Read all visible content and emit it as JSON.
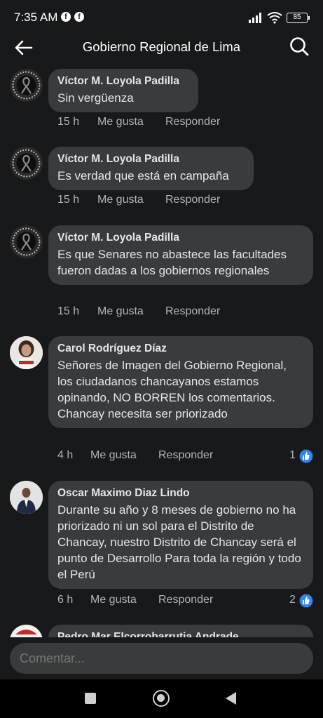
{
  "status_bar": {
    "time": "7:35 AM",
    "battery": "85",
    "icons": [
      "facebook-icon",
      "facebook-icon",
      "signal-icon",
      "wifi-icon",
      "battery-icon"
    ]
  },
  "header": {
    "title": "Gobierno Regional de Lima",
    "back_icon": "back-arrow-icon",
    "search_icon": "search-icon"
  },
  "comments": [
    {
      "author": "Víctor M. Loyola Padilla",
      "text": "Sin vergüenza",
      "time": "15 h",
      "like_label": "Me gusta",
      "reply_label": "Responder",
      "reactions": ""
    },
    {
      "author": "Víctor M. Loyola Padilla",
      "text": "Es verdad que está en campaña",
      "time": "15 h",
      "like_label": "Me gusta",
      "reply_label": "Responder",
      "reactions": ""
    },
    {
      "author": "Víctor M. Loyola Padilla",
      "text": "Es que Senares no abastece las facultades fueron dadas a los gobiernos regionales",
      "time": "15 h",
      "like_label": "Me gusta",
      "reply_label": "Responder",
      "reactions": ""
    },
    {
      "author": "Carol Rodríguez Díaz",
      "text": "Señores de Imagen del Gobierno Regional, los ciudadanos chancayanos estamos opinando, NO BORREN los comentarios.\nChancay necesita ser priorizado",
      "time": "4 h",
      "like_label": "Me gusta",
      "reply_label": "Responder",
      "reactions": "1"
    },
    {
      "author": "Oscar Maximo Diaz Lindo",
      "text": "Durante su año y 8 meses de gobierno no ha priorizado ni un sol para el Distrito de Chancay, nuestro Distrito de Chancay será el punto de Desarrollo Para toda la región y todo el Perú",
      "time": "6 h",
      "like_label": "Me gusta",
      "reply_label": "Responder",
      "reactions": "2"
    },
    {
      "author": "Pedro Mar Elcorrobarrutia Andrade"
    }
  ],
  "comment_box": {
    "placeholder": "Comentar..."
  },
  "colors": {
    "background": "#18191a",
    "bubble": "#3a3b3c",
    "like_blue": "#2d88ff"
  }
}
